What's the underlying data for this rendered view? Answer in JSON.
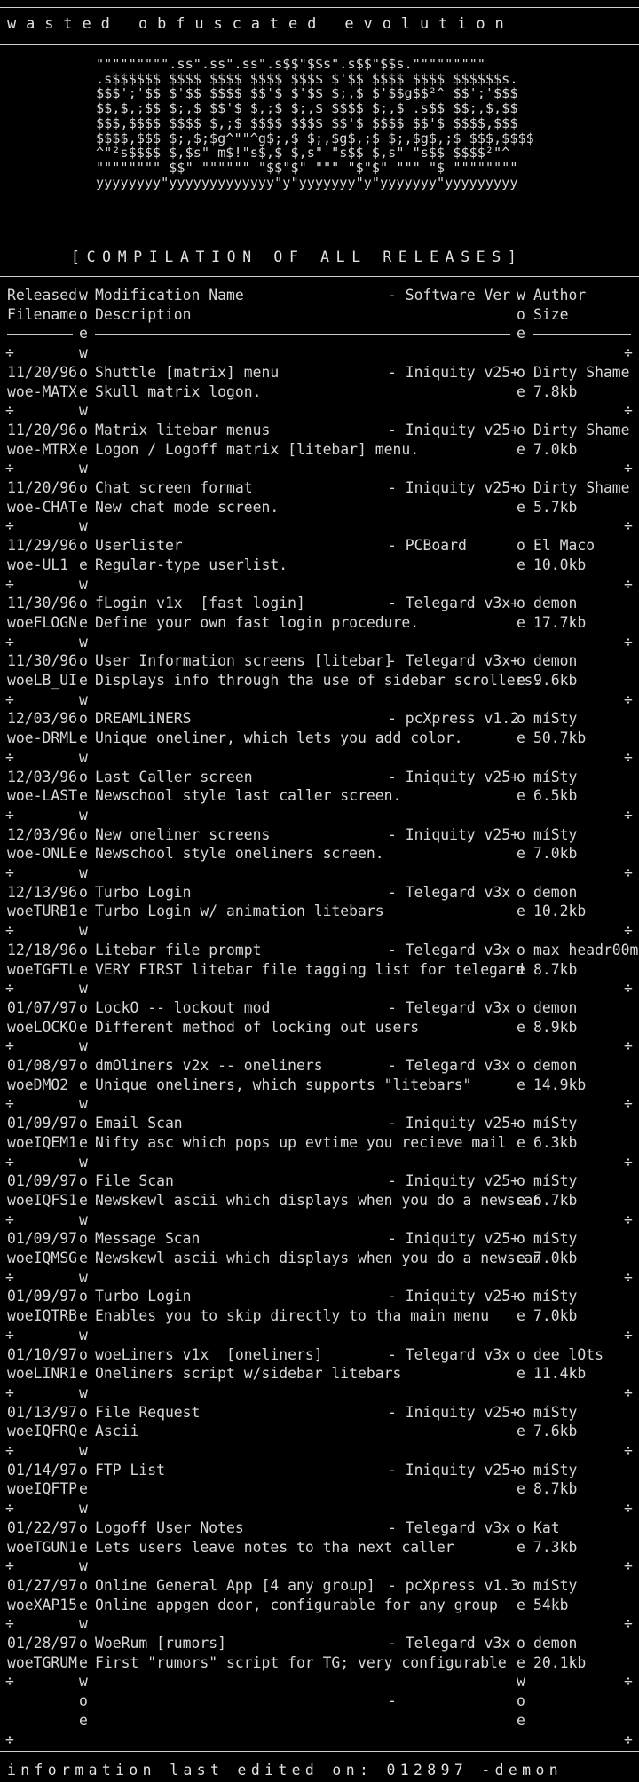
{
  "header": {
    "title": "wasted obfuscated evolution",
    "logo_lines": [
      "\"\"\"\"\"\"\"\"\".ss\".ss\".ss\".s$$\"$$s\".s$$\"$$s.\"\"\"\"\"\"\"\"\"",
      ".s$$$$$$ $$$$ $$$$ $$$$ $$$$ $'$$ $$$$ $$$$ $$$$$$s.",
      "$$$';'$$ $'$$ $$$$ $$'$ $'$$ $;,$ $'$$g$$²^ $$';'$$$",
      "$$,$,;$$ $;,$ $$'$ $,;$ $;,$ $$$$ $;,$ .s$$ $$;,$,$$",
      "$$$,$$$$ $$$$ $,;$ $$$$ $$$$ $$'$ $$$$ $$'$ $$$$,$$$",
      "$$$$,$$$ $;,$;$g^\"\"^g$;,$ $;,$g$,;$ $;,$g$,;$ $$$,$$$$",
      "^\"²s$$$$ $,$s\" m$!\"s$,$ $,s\" \"s$$ $,s\" \"s$$ $$$$²\"^",
      "\"\"\"\"\"\"\"\" $$\" \"\"\"\"\"\" \"$$\"$\" \"\"\" \"$\"$\" \"\"\" \"$ \"\"\"\"\"\"\"\"",
      "yyyyyyyy\"yyyyyyyyyyyyy\"y\"yyyyyyy\"y\"yyyyyyy\"yyyyyyyyy"
    ],
    "compilation_label": "[COMPILATION OF ALL RELEASES]"
  },
  "columns": {
    "row1": [
      "Released",
      "w",
      "Modification Name",
      "- Software Ver",
      "w",
      "Author"
    ],
    "row2": [
      "Filename",
      "o",
      "Description",
      "",
      "o",
      "Size"
    ],
    "sep_left": "e",
    "sep_right": "e"
  },
  "releases": [
    {
      "date": "11/20/96",
      "file": "woe-MATX",
      "name": "Shuttle [matrix] menu",
      "software": "- Iniquity v25+",
      "author": "Dirty Shame",
      "desc": "Skull matrix logon.",
      "size": "7.8kb"
    },
    {
      "date": "11/20/96",
      "file": "woe-MTRX",
      "name": "Matrix litebar menus",
      "software": "- Iniquity v25+",
      "author": "Dirty Shame",
      "desc": "Logon / Logoff matrix [litebar] menu.",
      "size": "7.0kb"
    },
    {
      "date": "11/20/96",
      "file": "woe-CHAT",
      "name": "Chat screen format",
      "software": "- Iniquity v25+",
      "author": "Dirty Shame",
      "desc": "New chat mode screen.",
      "size": "5.7kb"
    },
    {
      "date": "11/29/96",
      "file": "woe-UL1",
      "name": "Userlister",
      "software": "- PCBoard",
      "author": "El Maco",
      "desc": "Regular-type userlist.",
      "size": "10.0kb"
    },
    {
      "date": "11/30/96",
      "file": "woeFLOGN",
      "name": "fLogin v1x  [fast login]",
      "software": "- Telegard v3x+",
      "author": "demon",
      "desc": "Define your own fast login procedure.",
      "size": "17.7kb"
    },
    {
      "date": "11/30/96",
      "file": "woeLB_UI",
      "name": "User Information screens [litebar]",
      "software": "- Telegard v3x+",
      "author": "demon",
      "desc": "Displays info through tha use of sidebar scrollers.",
      "size": "9.6kb"
    },
    {
      "date": "12/03/96",
      "file": "woe-DRML",
      "name": "DREAMLiNERS",
      "software": "- pcXpress v1.2",
      "author": "míSty",
      "desc": "Unique oneliner, which lets you add color.",
      "size": "50.7kb"
    },
    {
      "date": "12/03/96",
      "file": "woe-LAST",
      "name": "Last Caller screen",
      "software": "- Iniquity v25+",
      "author": "míSty",
      "desc": "Newschool style last caller screen.",
      "size": "6.5kb"
    },
    {
      "date": "12/03/96",
      "file": "woe-ONLE",
      "name": "New oneliner screens",
      "software": "- Iniquity v25+",
      "author": "míSty",
      "desc": "Newschool style oneliners screen.",
      "size": "7.0kb"
    },
    {
      "date": "12/13/96",
      "file": "woeTURB1",
      "name": "Turbo Login",
      "software": "- Telegard v3x",
      "author": "demon",
      "desc": "Turbo Login w/ animation litebars",
      "size": "10.2kb"
    },
    {
      "date": "12/18/96",
      "file": "woeTGFTL",
      "name": "Litebar file prompt",
      "software": "- Telegard v3x",
      "author": "max headr00m",
      "desc": "VERY FIRST litebar file tagging list for telegard",
      "size": "8.7kb"
    },
    {
      "date": "01/07/97",
      "file": "woeLOCKO",
      "name": "LockO -- lockout mod",
      "software": "- Telegard v3x",
      "author": "demon",
      "desc": "Different method of locking out users",
      "size": "8.9kb"
    },
    {
      "date": "01/08/97",
      "file": "woeDMO2",
      "name": "dmOliners v2x -- oneliners",
      "software": "- Telegard v3x",
      "author": "demon",
      "desc": "Unique oneliners, which supports \"litebars\"",
      "size": "14.9kb"
    },
    {
      "date": "01/09/97",
      "file": "woeIQEM1",
      "name": "Email Scan",
      "software": "- Iniquity v25+",
      "author": "míSty",
      "desc": "Nifty asc which pops up evtime you recieve mail",
      "size": "6.3kb"
    },
    {
      "date": "01/09/97",
      "file": "woeIQFS1",
      "name": "File Scan",
      "software": "- Iniquity v25+",
      "author": "míSty",
      "desc": "Newskewl ascii which displays when you do a newscan",
      "size": "6.7kb"
    },
    {
      "date": "01/09/97",
      "file": "woeIQMSG",
      "name": "Message Scan",
      "software": "- Iniquity v25+",
      "author": "míSty",
      "desc": "Newskewl ascii which displays when you do a newscan",
      "size": "7.0kb"
    },
    {
      "date": "01/09/97",
      "file": "woeIQTRB",
      "name": "Turbo Login",
      "software": "- Iniquity v25+",
      "author": "míSty",
      "desc": "Enables you to skip directly to tha main menu",
      "size": "7.0kb"
    },
    {
      "date": "01/10/97",
      "file": "woeLINR1",
      "name": "woeLiners v1x  [oneliners]",
      "software": "- Telegard v3x",
      "author": "dee lOts",
      "desc": "Oneliners script w/sidebar litebars",
      "size": "11.4kb"
    },
    {
      "date": "01/13/97",
      "file": "woeIQFRQ",
      "name": "File Request",
      "software": "- Iniquity v25+",
      "author": "míSty",
      "desc": "Ascii",
      "size": "7.6kb"
    },
    {
      "date": "01/14/97",
      "file": "woeIQFTP",
      "name": "FTP List",
      "software": "- Iniquity v25+",
      "author": "míSty",
      "desc": "",
      "size": "8.7kb"
    },
    {
      "date": "01/22/97",
      "file": "woeTGUN1",
      "name": "Logoff User Notes",
      "software": "- Telegard v3x",
      "author": "Kat",
      "desc": "Lets users leave notes to tha next caller",
      "size": "7.3kb"
    },
    {
      "date": "01/27/97",
      "file": "woeXAP15",
      "name": "Online General App [4 any group]",
      "software": "- pcXpress v1.3",
      "author": "míSty",
      "desc": "Online appgen door, configurable for any group",
      "size": "54kb"
    },
    {
      "date": "01/28/97",
      "file": "woeTGRUM",
      "name": "WoeRum [rumors]",
      "software": "- Telegard v3x",
      "author": "demon",
      "desc": "First \"rumors\" script for TG; very configurable",
      "size": "20.1kb"
    }
  ],
  "tail": {
    "dash": "-"
  },
  "footer": {
    "text": "information last edited on: 012897 -demon"
  }
}
